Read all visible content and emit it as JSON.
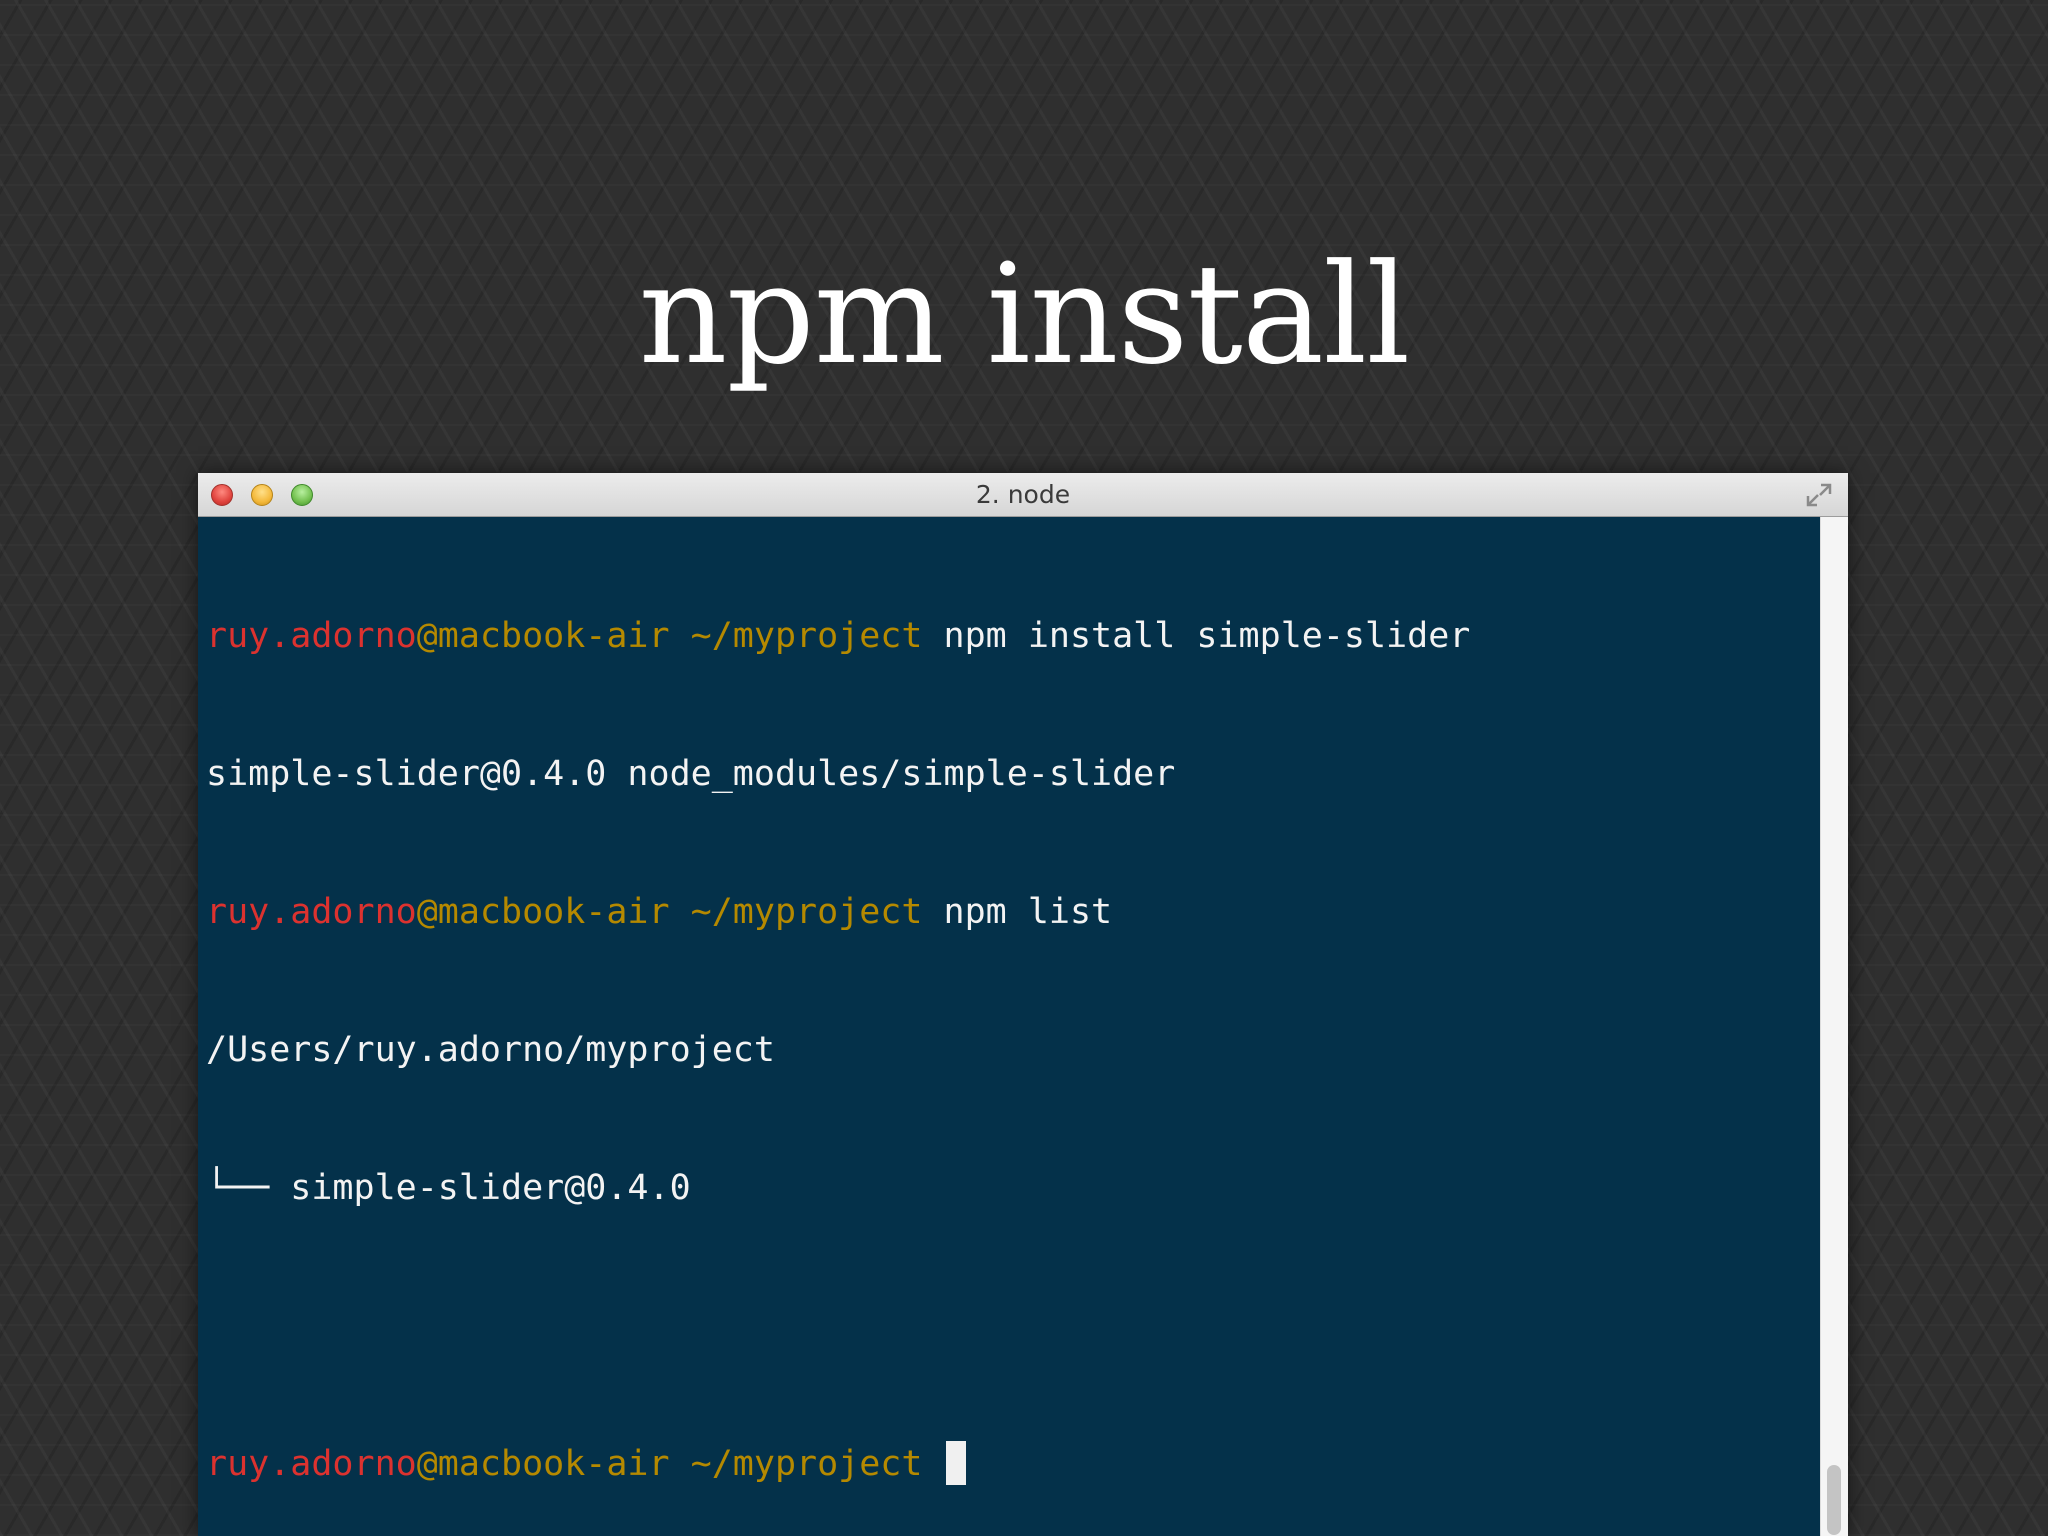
{
  "slide": {
    "title": "npm install"
  },
  "window": {
    "title": "2. node",
    "icons": {
      "close": "close-icon",
      "minimize": "minimize-icon",
      "zoom": "zoom-icon",
      "fullscreen": "fullscreen-icon"
    }
  },
  "terminal": {
    "colors": {
      "background": "#04314a",
      "user": "#dc322f",
      "host": "#b58900",
      "text": "#f3f3f3"
    },
    "lines": [
      {
        "prompt": {
          "user": "ruy.adorno",
          "host": "@macbook-air",
          "path": " ~/myproject"
        },
        "command": " npm install simple-slider"
      },
      {
        "output": "simple-slider@0.4.0 node_modules/simple-slider"
      },
      {
        "prompt": {
          "user": "ruy.adorno",
          "host": "@macbook-air",
          "path": " ~/myproject"
        },
        "command": " npm list"
      },
      {
        "output": "/Users/ruy.adorno/myproject"
      },
      {
        "output": "└── simple-slider@0.4.0"
      },
      {
        "output": ""
      },
      {
        "prompt": {
          "user": "ruy.adorno",
          "host": "@macbook-air",
          "path": " ~/myproject"
        },
        "command": " "
      }
    ]
  }
}
